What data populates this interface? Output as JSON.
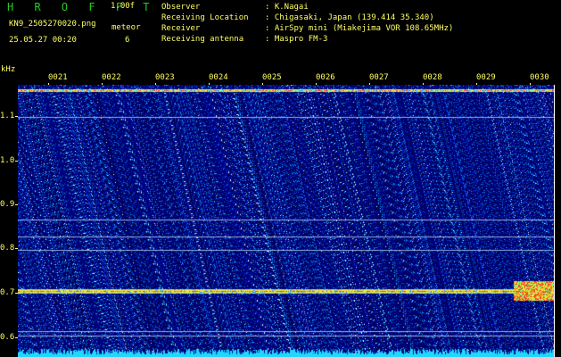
{
  "header": {
    "brand": "H R O F F T",
    "version": "1.00f",
    "file_name": "KN9_2505270020.png",
    "timestamp": "25.05.27 00:20",
    "meteor_label": "meteor",
    "meteor_count": "6",
    "observer_label": "Observer",
    "observer_value": ": K.Nagai",
    "location_label": "Receiving Location",
    "location_value": ": Chigasaki, Japan (139.414 35.340)",
    "receiver_label": "Receiver",
    "receiver_value": ": AirSpy mini (Miakejima VOR 108.65MHz)",
    "antenna_label": "Receiving antenna",
    "antenna_value": ": Maspro FM-3"
  },
  "axes": {
    "y_unit": "kHz",
    "y_ticks": [
      "1.1",
      "1.0",
      "0.9",
      "0.8",
      "0.7",
      "0.6"
    ],
    "x_ticks": [
      "0021",
      "0022",
      "0023",
      "0024",
      "0025",
      "0026",
      "0027",
      "0028",
      "0029",
      "0030"
    ]
  },
  "colors": {
    "background": "#000000",
    "label": "#ffff66",
    "brand": "#28c828",
    "noise_floor": "#00008c",
    "signal_hot": "#ff3030",
    "bottom_band": "#20d8ff"
  }
}
